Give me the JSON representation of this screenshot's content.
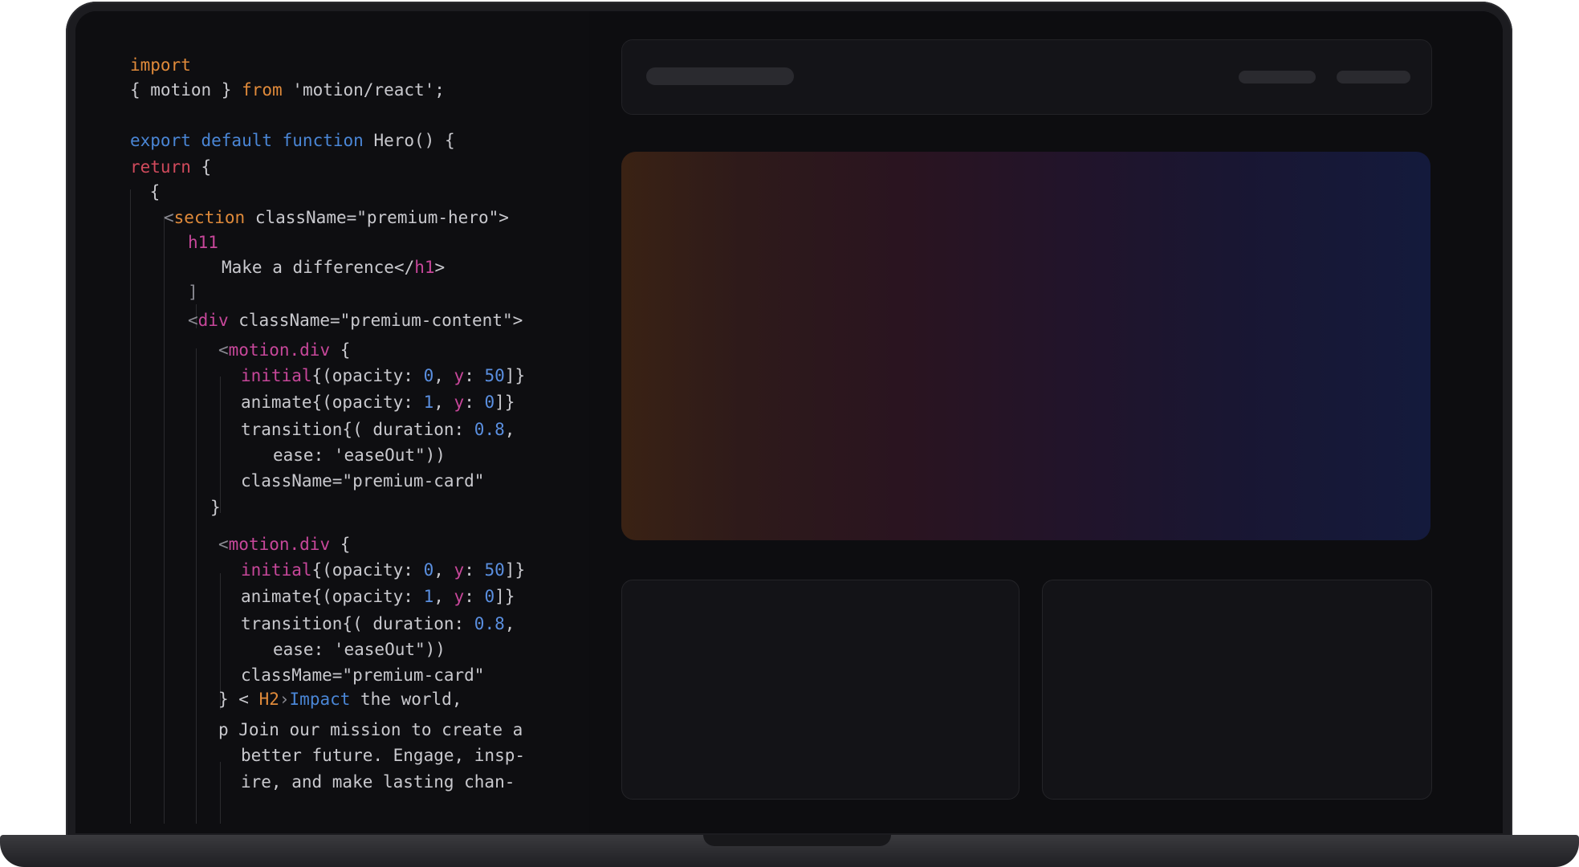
{
  "code_lines": [
    {
      "parts": [
        {
          "t": "import",
          "c": "kw-orange"
        }
      ]
    },
    {
      "parts": [
        {
          "t": "{ motion } ",
          "c": ""
        },
        {
          "t": "from",
          "c": "kw-orange"
        },
        {
          "t": " 'motion/react';",
          "c": ""
        }
      ]
    },
    {
      "parts": [
        {
          "t": "export default function",
          "c": "kw-blue"
        },
        {
          "t": " Hero() {",
          "c": ""
        }
      ]
    },
    {
      "parts": [
        {
          "t": "return",
          "c": "kw-red"
        },
        {
          "t": " {",
          "c": ""
        }
      ]
    },
    {
      "parts": [
        {
          "t": " {",
          "c": ""
        }
      ]
    },
    {
      "parts": [
        {
          "t": "<",
          "c": "dim"
        },
        {
          "t": "section",
          "c": "kw-orange"
        },
        {
          "t": " className=\"premium-hero\">",
          "c": ""
        }
      ]
    },
    {
      "parts": [
        {
          "t": "h11",
          "c": "kw-pink"
        }
      ]
    },
    {
      "parts": [
        {
          "t": "Make a difference</",
          "c": ""
        },
        {
          "t": "h1",
          "c": "kw-pink"
        },
        {
          "t": ">",
          "c": ""
        }
      ]
    },
    {
      "parts": [
        {
          "t": "]",
          "c": "dim"
        }
      ]
    },
    {
      "parts": [
        {
          "t": "<",
          "c": "dim"
        },
        {
          "t": "div",
          "c": "kw-pink"
        },
        {
          "t": " className=\"premium-content\">",
          "c": ""
        }
      ]
    },
    {
      "parts": [
        {
          "t": "<",
          "c": "dim"
        },
        {
          "t": "motion.div",
          "c": "kw-pink"
        },
        {
          "t": " {",
          "c": ""
        }
      ]
    },
    {
      "parts": [
        {
          "t": "initial",
          "c": "kw-pink"
        },
        {
          "t": "{(opacity: ",
          "c": ""
        },
        {
          "t": "0",
          "c": "num"
        },
        {
          "t": ", ",
          "c": ""
        },
        {
          "t": "y",
          "c": "kw-pink"
        },
        {
          "t": ": ",
          "c": ""
        },
        {
          "t": "50",
          "c": "num"
        },
        {
          "t": "]}",
          "c": ""
        }
      ]
    },
    {
      "parts": [
        {
          "t": "animate{(opacity: ",
          "c": ""
        },
        {
          "t": "1",
          "c": "num"
        },
        {
          "t": ", ",
          "c": ""
        },
        {
          "t": "y",
          "c": "kw-pink"
        },
        {
          "t": ": ",
          "c": ""
        },
        {
          "t": "0",
          "c": "num"
        },
        {
          "t": "]}",
          "c": ""
        }
      ]
    },
    {
      "parts": [
        {
          "t": "transition{( duration: ",
          "c": ""
        },
        {
          "t": "0.8",
          "c": "num"
        },
        {
          "t": ",",
          "c": ""
        }
      ]
    },
    {
      "parts": [
        {
          "t": "ease: 'easeOut\"))",
          "c": ""
        }
      ]
    },
    {
      "parts": [
        {
          "t": "className=\"premium-card\"",
          "c": ""
        }
      ]
    },
    {
      "parts": [
        {
          "t": "}",
          "c": ""
        }
      ]
    },
    {
      "parts": [
        {
          "t": "<",
          "c": "dim"
        },
        {
          "t": "motion.div",
          "c": "kw-pink"
        },
        {
          "t": " {",
          "c": ""
        }
      ]
    },
    {
      "parts": [
        {
          "t": "initial",
          "c": "kw-pink"
        },
        {
          "t": "{(opacity: ",
          "c": ""
        },
        {
          "t": "0",
          "c": "num"
        },
        {
          "t": ", ",
          "c": ""
        },
        {
          "t": "y",
          "c": "kw-pink"
        },
        {
          "t": ": ",
          "c": ""
        },
        {
          "t": "50",
          "c": "num"
        },
        {
          "t": "]}",
          "c": ""
        }
      ]
    },
    {
      "parts": [
        {
          "t": "animate{(opacity: ",
          "c": ""
        },
        {
          "t": "1",
          "c": "num"
        },
        {
          "t": ", ",
          "c": ""
        },
        {
          "t": "y",
          "c": "kw-pink"
        },
        {
          "t": ": ",
          "c": ""
        },
        {
          "t": "0",
          "c": "num"
        },
        {
          "t": "]}",
          "c": ""
        }
      ]
    },
    {
      "parts": [
        {
          "t": "transition{( duration: ",
          "c": ""
        },
        {
          "t": "0.8",
          "c": "num"
        },
        {
          "t": ",",
          "c": ""
        }
      ]
    },
    {
      "parts": [
        {
          "t": "ease: 'easeOut\"))",
          "c": ""
        }
      ]
    },
    {
      "parts": [
        {
          "t": "classMame=\"premium-card\"",
          "c": ""
        }
      ]
    },
    {
      "parts": [
        {
          "t": "} < ",
          "c": ""
        },
        {
          "t": "H2",
          "c": "kw-orange"
        },
        {
          "t": "›",
          "c": "dim"
        },
        {
          "t": "Impact",
          "c": "kw-blue"
        },
        {
          "t": " the world,",
          "c": ""
        }
      ]
    },
    {
      "parts": [
        {
          "t": "p Join our mission to create a",
          "c": ""
        }
      ]
    },
    {
      "parts": [
        {
          "t": "better future. Engage, insp-",
          "c": ""
        }
      ]
    },
    {
      "parts": [
        {
          "t": "ire, and make lasting chan-",
          "c": ""
        }
      ]
    }
  ],
  "colors": {
    "keyword_orange": "#e08a3a",
    "keyword_blue": "#4a86d6",
    "keyword_red": "#d04a5c",
    "keyword_pink": "#c7479a",
    "number_blue": "#5a8fe0"
  }
}
